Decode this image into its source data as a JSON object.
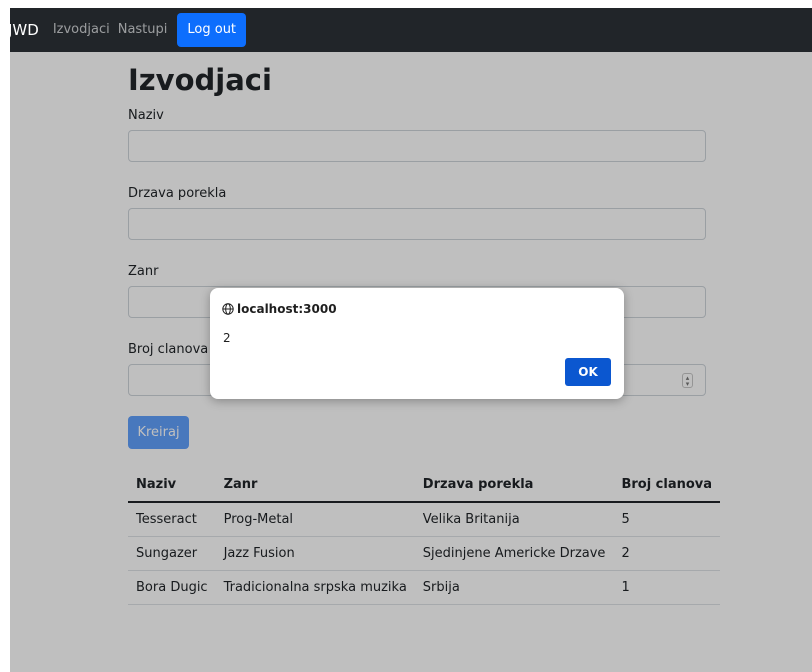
{
  "navbar": {
    "brand": "JWD",
    "links": [
      "Izvodjaci",
      "Nastupi"
    ],
    "logout_label": "Log out"
  },
  "page": {
    "title": "Izvodjaci"
  },
  "form": {
    "naziv_label": "Naziv",
    "naziv_value": "",
    "drzava_label": "Drzava porekla",
    "drzava_value": "",
    "zanr_label": "Zanr",
    "zanr_value": "",
    "broj_label": "Broj clanova",
    "broj_value": "",
    "submit_label": "Kreiraj"
  },
  "table": {
    "headers": [
      "Naziv",
      "Zanr",
      "Drzava porekla",
      "Broj clanova"
    ],
    "rows": [
      [
        "Tesseract",
        "Prog-Metal",
        "Velika Britanija",
        "5"
      ],
      [
        "Sungazer",
        "Jazz Fusion",
        "Sjedinjene Americke Drzave",
        "2"
      ],
      [
        "Bora Dugic",
        "Tradicionalna srpska muzika",
        "Srbija",
        "1"
      ]
    ]
  },
  "dialog": {
    "origin": "localhost:3000",
    "message": "2",
    "ok_label": "OK",
    "icon": "globe-icon"
  },
  "colors": {
    "navbar_bg": "#212529",
    "primary": "#0d6efd",
    "dialog_ok": "#0b57d0"
  }
}
